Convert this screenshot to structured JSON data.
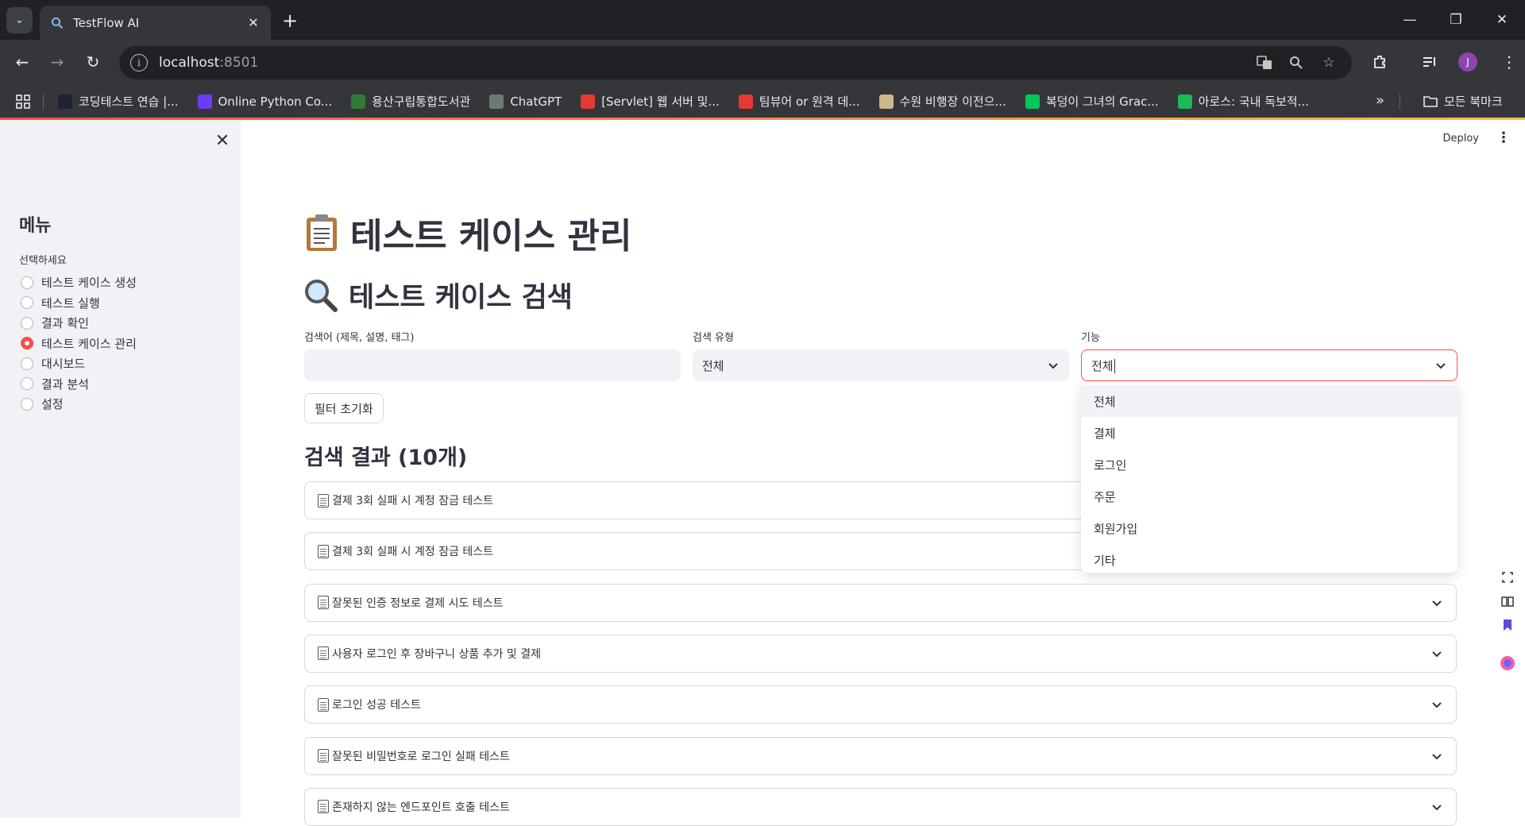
{
  "browser": {
    "tab_title": "TestFlow AI",
    "url_host": "localhost",
    "url_port": ":8501",
    "profile_initial": "J",
    "bookmarks": [
      {
        "label": "코딩테스트 연습 |...",
        "color": "#1f2235"
      },
      {
        "label": "Online Python Co...",
        "color": "#6c3df4"
      },
      {
        "label": "용산구립통합도서관",
        "color": "#2e7d32"
      },
      {
        "label": "ChatGPT",
        "color": "#6b7b73"
      },
      {
        "label": "[Servlet] 웹 서버 및...",
        "color": "#e53935"
      },
      {
        "label": "팀뷰어 or 원격 데...",
        "color": "#e53935"
      },
      {
        "label": "수원 비행장 이전으...",
        "color": "#c9b98a"
      },
      {
        "label": "복덩이 그녀의 Grac...",
        "color": "#03c75a"
      },
      {
        "label": "아로스: 국내 독보적...",
        "color": "#1db954"
      }
    ],
    "all_bookmarks": "모든 북마크"
  },
  "sidebar": {
    "title": "메뉴",
    "radio_label": "선택하세요",
    "options": [
      "테스트 케이스 생성",
      "테스트 실행",
      "결과 확인",
      "테스트 케이스 관리",
      "대시보드",
      "결과 분석",
      "설정"
    ],
    "selected": "테스트 케이스 관리"
  },
  "header": {
    "deploy": "Deploy"
  },
  "main": {
    "title": "테스트 케이스 관리",
    "search_heading": "테스트 케이스 검색",
    "search_label": "검색어 (제목, 설명, 태그)",
    "search_value": "",
    "type_label": "검색 유형",
    "type_value": "전체",
    "feature_label": "기능",
    "feature_value": "전체",
    "reset_button": "필터 초기화",
    "results_heading": "검색 결과 (10개)",
    "results": [
      "결제 3회 실패 시 계정 잠금 테스트",
      "결제 3회 실패 시 계정 잠금 테스트",
      "잘못된 인증 정보로 결제 시도 테스트",
      "사용자 로그인 후 장바구니 상품 추가 및 결제",
      "로그인 성공 테스트",
      "잘못된 비밀번호로 로그인 실패 테스트",
      "존재하지 않는 엔드포인트 호출 테스트"
    ]
  },
  "dropdown": {
    "options": [
      "전체",
      "결제",
      "로그인",
      "주문",
      "회원가입",
      "기타"
    ],
    "highlighted": "전체"
  },
  "colors": {
    "accent": "#ff4b4b",
    "sidebar_bg": "#f0f2f6",
    "text": "#31333f"
  }
}
